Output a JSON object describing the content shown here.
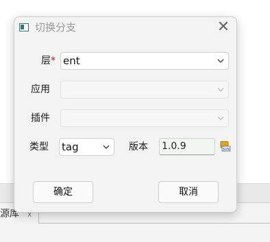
{
  "background": {
    "tab_label": "源库",
    "tab_close": "☓"
  },
  "dialog": {
    "title": "切换分支",
    "close_glyph": "✕",
    "fields": {
      "layer": {
        "label": "层",
        "required_mark": "*",
        "value": "ent"
      },
      "app": {
        "label": "应用",
        "value": ""
      },
      "plugin": {
        "label": "插件",
        "value": ""
      },
      "type": {
        "label": "类型",
        "value": "tag"
      },
      "version": {
        "label": "版本",
        "value": "1.0.9"
      }
    },
    "svn_icon_text": "SVN",
    "buttons": {
      "ok": "确定",
      "cancel": "取消"
    }
  },
  "colors": {
    "title_icon": "#3d6e70",
    "required": "#d01010",
    "version_bg": "#f2f6f0"
  }
}
